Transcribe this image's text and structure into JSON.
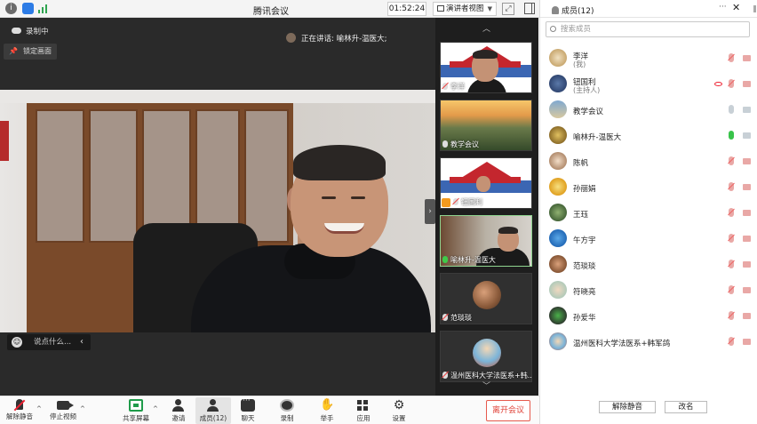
{
  "window": {
    "title": "腾讯会议",
    "timer": "01:52:24",
    "view_mode": "演讲者视图",
    "info_icon": "i"
  },
  "stage": {
    "recording_label": "录制中",
    "pin_label": "锁定画面",
    "speaking_label": "正在讲话: 喻林升-温医大;",
    "chat_placeholder": "说点什么...",
    "chat_collapse_icon": "‹",
    "strip_handle_icon": "›"
  },
  "thumbnails": [
    {
      "name": "李洋",
      "mic": "muted"
    },
    {
      "name": "教学会议",
      "mic": "white"
    },
    {
      "name": "钮国利",
      "mic": "muted"
    },
    {
      "name": "喻林升-温医大",
      "mic": "green"
    },
    {
      "name": "范琰琰",
      "mic": "muted"
    },
    {
      "name": "温州医科大学法医系+韩...",
      "mic": "muted"
    }
  ],
  "toolbar": {
    "unmute": "解除静音",
    "stop_video": "停止视频",
    "share_screen": "共享屏幕",
    "invite": "邀请",
    "members": "成员(12)",
    "chat": "聊天",
    "record": "录制",
    "raise_hand": "举手",
    "apps": "应用",
    "settings": "设置",
    "leave": "离开会议",
    "caret": "^",
    "hand_glyph": "✋",
    "gear_glyph": "⚙"
  },
  "members_panel": {
    "title": "成员(12)",
    "more": "···",
    "close": "✕",
    "search_placeholder": "搜索成员",
    "members": [
      {
        "name": "李洋",
        "role": "(我)",
        "mic": "off",
        "cam": "off"
      },
      {
        "name": "钮国利",
        "role": "(主持人)",
        "mic": "off",
        "cam": "off",
        "eye": true
      },
      {
        "name": "教学会议",
        "role": "",
        "mic": "grey",
        "cam": "grey"
      },
      {
        "name": "喻林升-温医大",
        "role": "",
        "mic": "on",
        "cam": "grey"
      },
      {
        "name": "陈帆",
        "role": "",
        "mic": "off",
        "cam": "off"
      },
      {
        "name": "孙丽娟",
        "role": "",
        "mic": "off",
        "cam": "off"
      },
      {
        "name": "王珏",
        "role": "",
        "mic": "off",
        "cam": "off"
      },
      {
        "name": "午方宇",
        "role": "",
        "mic": "off",
        "cam": "off"
      },
      {
        "name": "范琰琰",
        "role": "",
        "mic": "off",
        "cam": "off"
      },
      {
        "name": "符晓亮",
        "role": "",
        "mic": "off",
        "cam": "off"
      },
      {
        "name": "孙爱华",
        "role": "",
        "mic": "off",
        "cam": "off"
      },
      {
        "name": "温州医科大学法医系+韩军鸽",
        "role": "",
        "mic": "off",
        "cam": "off"
      }
    ],
    "unmute_all": "解除静音",
    "rename": "改名"
  }
}
